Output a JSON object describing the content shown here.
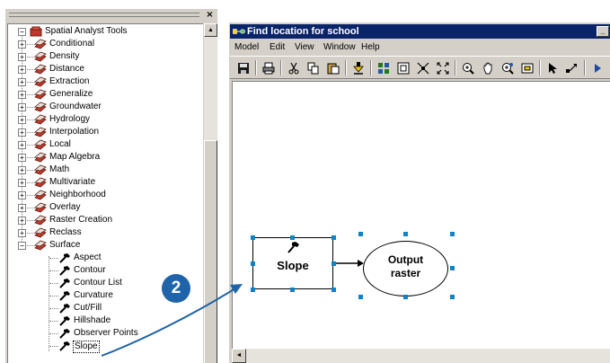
{
  "toolbox": {
    "close_glyph": "×",
    "root": {
      "label": "Spatial Analyst Tools",
      "expander": "−"
    },
    "toolsets": [
      {
        "label": "Conditional",
        "expander": "+"
      },
      {
        "label": "Density",
        "expander": "+"
      },
      {
        "label": "Distance",
        "expander": "+"
      },
      {
        "label": "Extraction",
        "expander": "+"
      },
      {
        "label": "Generalize",
        "expander": "+"
      },
      {
        "label": "Groundwater",
        "expander": "+"
      },
      {
        "label": "Hydrology",
        "expander": "+"
      },
      {
        "label": "Interpolation",
        "expander": "+"
      },
      {
        "label": "Local",
        "expander": "+"
      },
      {
        "label": "Map Algebra",
        "expander": "+"
      },
      {
        "label": "Math",
        "expander": "+"
      },
      {
        "label": "Multivariate",
        "expander": "+"
      },
      {
        "label": "Neighborhood",
        "expander": "+"
      },
      {
        "label": "Overlay",
        "expander": "+"
      },
      {
        "label": "Raster Creation",
        "expander": "+"
      },
      {
        "label": "Reclass",
        "expander": "+"
      },
      {
        "label": "Surface",
        "expander": "−"
      }
    ],
    "surface_tools": [
      {
        "label": "Aspect"
      },
      {
        "label": "Contour"
      },
      {
        "label": "Contour List"
      },
      {
        "label": "Curvature"
      },
      {
        "label": "Cut/Fill"
      },
      {
        "label": "Hillshade"
      },
      {
        "label": "Observer Points"
      },
      {
        "label": "Slope"
      }
    ],
    "scroll_up_glyph": "▲"
  },
  "model_window": {
    "title": "Find location for school",
    "minimize_glyph": "_",
    "menu": [
      "Model",
      "Edit",
      "View",
      "Window",
      "Help"
    ],
    "toolbar_icons": [
      "save-icon",
      "print-icon",
      "cut-icon",
      "copy-icon",
      "paste-icon",
      "add-data-icon",
      "auto-layout-icon",
      "full-extent-icon",
      "zoom-in-fixed-icon",
      "zoom-out-fixed-icon",
      "zoom-in-icon",
      "pan-icon",
      "continuous-zoom-icon",
      "overview-icon",
      "select-icon",
      "connect-icon",
      "run-icon"
    ],
    "hscroll_left_glyph": "◄",
    "tool_element": {
      "label": "Slope"
    },
    "output_element": {
      "label": "Output\nraster"
    }
  },
  "callout": {
    "number": "2"
  },
  "colors": {
    "titlebar": "#0a246a",
    "toolset_icon": "#c0392b",
    "selection_handle": "#0a84c8",
    "callout": "#1f63a8"
  }
}
